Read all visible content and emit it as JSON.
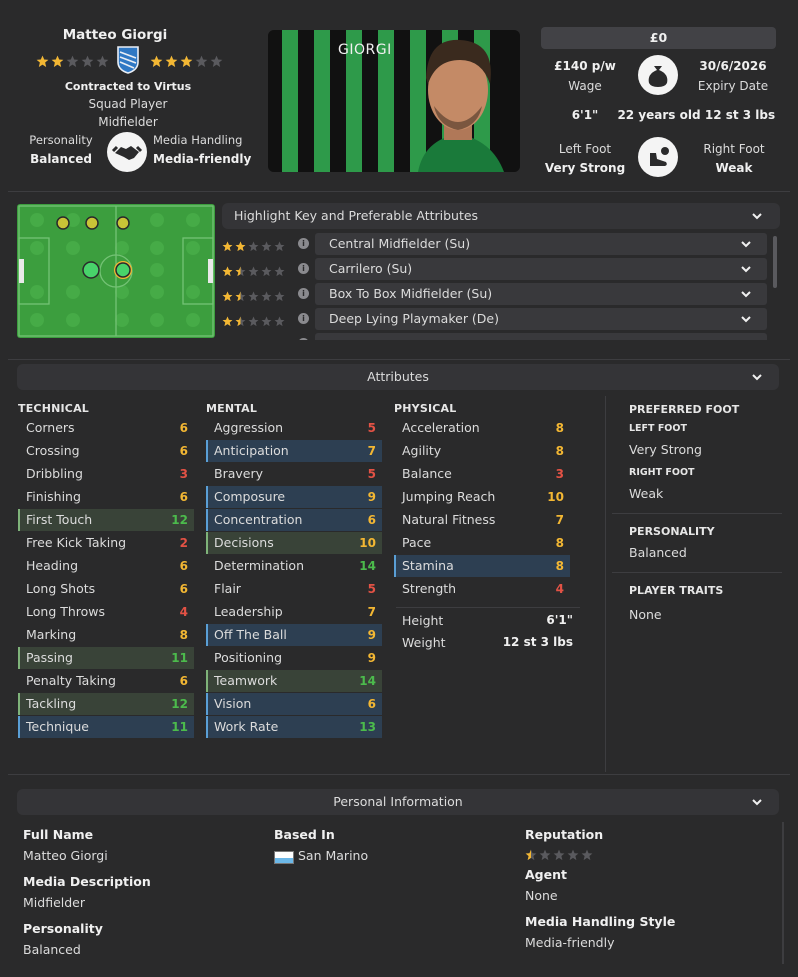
{
  "header": {
    "name": "Matteo Giorgi",
    "contract": "Contracted to Virtus",
    "squad_status": "Squad Player",
    "position": "Midfielder",
    "personality_label": "Personality",
    "personality_value": "Balanced",
    "media_label": "Media Handling",
    "media_value": "Media-friendly",
    "shirt_name": "GIORGI",
    "current_ability_stars": 2,
    "potential_ability_stars": 3,
    "value": "£0",
    "wage": "£140 p/w",
    "wage_label": "Wage",
    "expiry": "30/6/2026",
    "expiry_label": "Expiry Date",
    "height": "6'1\"",
    "age": "22 years old",
    "weight": "12 st 3 lbs",
    "left_foot_label": "Left Foot",
    "left_foot_value": "Very Strong",
    "right_foot_label": "Right Foot",
    "right_foot_value": "Weak"
  },
  "roles": {
    "highlight_label": "Highlight Key and Preferable Attributes",
    "items": [
      {
        "name": "Central Midfielder (Su)",
        "stars": 2
      },
      {
        "name": "Carrilero (Su)",
        "stars": 1.5
      },
      {
        "name": "Box To Box Midfielder (Su)",
        "stars": 1.5
      },
      {
        "name": "Deep Lying Playmaker (De)",
        "stars": 1.5
      }
    ]
  },
  "attributes": {
    "title": "Attributes",
    "technical_label": "TECHNICAL",
    "mental_label": "MENTAL",
    "physical_label": "PHYSICAL",
    "technical": [
      {
        "name": "Corners",
        "value": "6",
        "hl": ""
      },
      {
        "name": "Crossing",
        "value": "6",
        "hl": ""
      },
      {
        "name": "Dribbling",
        "value": "3",
        "hl": ""
      },
      {
        "name": "Finishing",
        "value": "6",
        "hl": ""
      },
      {
        "name": "First Touch",
        "value": "12",
        "hl": "g"
      },
      {
        "name": "Free Kick Taking",
        "value": "2",
        "hl": ""
      },
      {
        "name": "Heading",
        "value": "6",
        "hl": ""
      },
      {
        "name": "Long Shots",
        "value": "6",
        "hl": ""
      },
      {
        "name": "Long Throws",
        "value": "4",
        "hl": ""
      },
      {
        "name": "Marking",
        "value": "8",
        "hl": ""
      },
      {
        "name": "Passing",
        "value": "11",
        "hl": "g"
      },
      {
        "name": "Penalty Taking",
        "value": "6",
        "hl": ""
      },
      {
        "name": "Tackling",
        "value": "12",
        "hl": "g"
      },
      {
        "name": "Technique",
        "value": "11",
        "hl": "b"
      }
    ],
    "mental": [
      {
        "name": "Aggression",
        "value": "5",
        "hl": ""
      },
      {
        "name": "Anticipation",
        "value": "7",
        "hl": "b"
      },
      {
        "name": "Bravery",
        "value": "5",
        "hl": ""
      },
      {
        "name": "Composure",
        "value": "9",
        "hl": "b"
      },
      {
        "name": "Concentration",
        "value": "6",
        "hl": "b"
      },
      {
        "name": "Decisions",
        "value": "10",
        "hl": "g"
      },
      {
        "name": "Determination",
        "value": "14",
        "hl": ""
      },
      {
        "name": "Flair",
        "value": "5",
        "hl": ""
      },
      {
        "name": "Leadership",
        "value": "7",
        "hl": ""
      },
      {
        "name": "Off The Ball",
        "value": "9",
        "hl": "b"
      },
      {
        "name": "Positioning",
        "value": "9",
        "hl": ""
      },
      {
        "name": "Teamwork",
        "value": "14",
        "hl": "g"
      },
      {
        "name": "Vision",
        "value": "6",
        "hl": "b"
      },
      {
        "name": "Work Rate",
        "value": "13",
        "hl": "b"
      }
    ],
    "physical": [
      {
        "name": "Acceleration",
        "value": "8",
        "hl": ""
      },
      {
        "name": "Agility",
        "value": "8",
        "hl": ""
      },
      {
        "name": "Balance",
        "value": "3",
        "hl": ""
      },
      {
        "name": "Jumping Reach",
        "value": "10",
        "hl": ""
      },
      {
        "name": "Natural Fitness",
        "value": "7",
        "hl": ""
      },
      {
        "name": "Pace",
        "value": "8",
        "hl": ""
      },
      {
        "name": "Stamina",
        "value": "8",
        "hl": "b"
      },
      {
        "name": "Strength",
        "value": "4",
        "hl": ""
      }
    ],
    "height_label": "Height",
    "height_value": "6'1\"",
    "weight_label": "Weight",
    "weight_value": "12 st 3 lbs"
  },
  "side": {
    "preferred_foot": "PREFERRED FOOT",
    "left_foot": "LEFT FOOT",
    "left_foot_value": "Very Strong",
    "right_foot": "RIGHT FOOT",
    "right_foot_value": "Weak",
    "personality": "PERSONALITY",
    "personality_value": "Balanced",
    "traits": "PLAYER TRAITS",
    "traits_value": "None"
  },
  "personal": {
    "title": "Personal Information",
    "full_name_label": "Full Name",
    "full_name": "Matteo Giorgi",
    "media_desc_label": "Media Description",
    "media_desc": "Midfielder",
    "personality_label": "Personality",
    "personality": "Balanced",
    "based_in_label": "Based In",
    "based_in": "San Marino",
    "reputation_label": "Reputation",
    "reputation_stars": 0.5,
    "agent_label": "Agent",
    "agent": "None",
    "media_style_label": "Media Handling Style",
    "media_style": "Media-friendly"
  },
  "colors": {
    "pitch": "#3c9e3e",
    "gold": "#f3b733",
    "green_hl": "#7fb37a",
    "blue_hl": "#5a9fd6"
  }
}
